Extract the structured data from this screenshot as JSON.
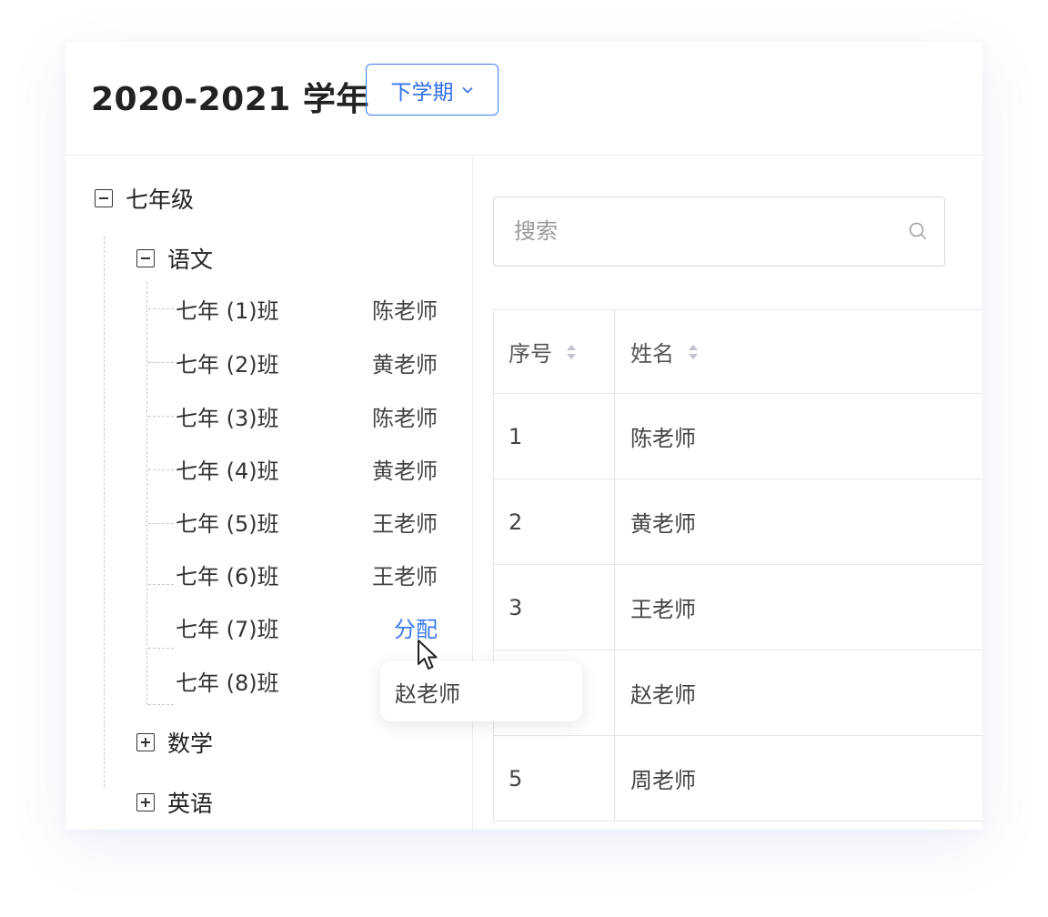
{
  "header": {
    "year_title": "2020-2021 学年",
    "term_selected": "下学期"
  },
  "tree": {
    "grade": {
      "label": "七年级",
      "expanded": true
    },
    "subjects": [
      {
        "label": "语文",
        "expanded": true
      },
      {
        "label": "数学",
        "expanded": false
      },
      {
        "label": "英语",
        "expanded": false
      }
    ],
    "classes": [
      {
        "name": "七年 (1)班",
        "teacher": "陈老师"
      },
      {
        "name": "七年 (2)班",
        "teacher": "黄老师"
      },
      {
        "name": "七年 (3)班",
        "teacher": "陈老师"
      },
      {
        "name": "七年 (4)班",
        "teacher": "黄老师"
      },
      {
        "name": "七年 (5)班",
        "teacher": "王老师"
      },
      {
        "name": "七年 (6)班",
        "teacher": "王老师"
      },
      {
        "name": "七年 (7)班",
        "teacher": "分配"
      },
      {
        "name": "七年 (8)班",
        "teacher": ""
      }
    ]
  },
  "popup": {
    "option": "赵老师"
  },
  "search": {
    "placeholder": "搜索",
    "value": ""
  },
  "table": {
    "columns": [
      "序号",
      "姓名"
    ],
    "rows": [
      {
        "index": "1",
        "name": "陈老师"
      },
      {
        "index": "2",
        "name": "黄老师"
      },
      {
        "index": "3",
        "name": "王老师"
      },
      {
        "index": "",
        "name": "赵老师"
      },
      {
        "index": "5",
        "name": "周老师"
      }
    ]
  },
  "colors": {
    "accent": "#3a7bf0",
    "border": "#e6e6e6"
  },
  "icons": [
    "chevron-down-icon",
    "minus-square-icon",
    "plus-square-icon",
    "search-icon",
    "sort-icon",
    "mouse-cursor-icon"
  ]
}
